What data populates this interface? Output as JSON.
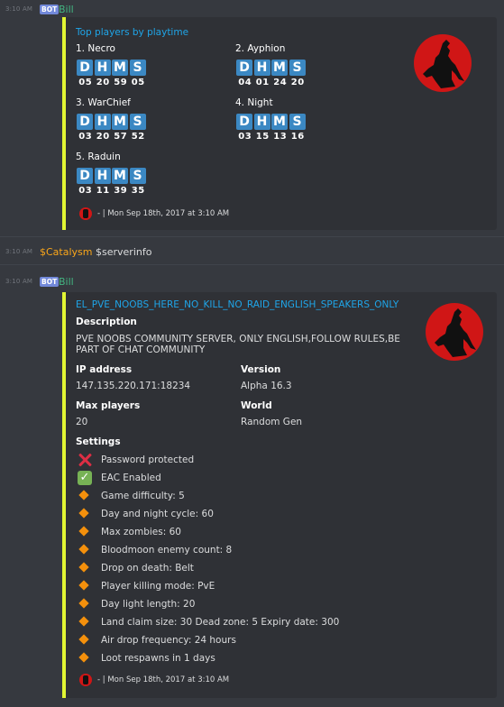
{
  "colors": {
    "accent_bar": "#e1f533",
    "title_link": "#1fa5e8",
    "bot_name": "#43b581",
    "user_name": "#faa61a",
    "badge": "#3b88c3",
    "thumb_red": "#d01616"
  },
  "msg1": {
    "timestamp": "3:10 AM",
    "bot_tag": "BOT",
    "author": "Bill",
    "embed": {
      "title": "Top players by playtime",
      "players": [
        {
          "name": "1. Necro",
          "letters": [
            "D",
            "H",
            "M",
            "S"
          ],
          "values": [
            "05",
            "20",
            "59",
            "05"
          ]
        },
        {
          "name": "2. Ayphion",
          "letters": [
            "D",
            "H",
            "M",
            "S"
          ],
          "values": [
            "04",
            "01",
            "24",
            "20"
          ]
        },
        {
          "name": "3. WarChief",
          "letters": [
            "D",
            "H",
            "M",
            "S"
          ],
          "values": [
            "03",
            "20",
            "57",
            "52"
          ]
        },
        {
          "name": "4. Night",
          "letters": [
            "D",
            "H",
            "M",
            "S"
          ],
          "values": [
            "03",
            "15",
            "13",
            "16"
          ]
        },
        {
          "name": "5. Raduin",
          "letters": [
            "D",
            "H",
            "M",
            "S"
          ],
          "values": [
            "03",
            "11",
            "39",
            "35"
          ]
        }
      ],
      "thumbnail_icon": "zombie-silhouette-icon",
      "footer": "- | Mon Sep 18th, 2017 at 3:10 AM"
    }
  },
  "msg2": {
    "timestamp": "3:10 AM",
    "author": "$Catalysm",
    "content": "$serverinfo"
  },
  "msg3": {
    "timestamp": "3:10 AM",
    "bot_tag": "BOT",
    "author": "Bill",
    "embed": {
      "title": "EL_PVE_NOOBS_HERE_NO_KILL_NO_RAID_ENGLISH_SPEAKERS_ONLY",
      "description_label": "Description",
      "description_line1": "PVE NOOBS COMMUNITY SERVER, ONLY ENGLISH,FOLLOW RULES,BE",
      "description_line2": "PART OF CHAT COMMUNITY",
      "ip_label": "IP address",
      "ip_value": "147.135.220.171:18234",
      "version_label": "Version",
      "version_value": "Alpha 16.3",
      "maxplayers_label": "Max players",
      "maxplayers_value": "20",
      "world_label": "World",
      "world_value": "Random Gen",
      "settings_label": "Settings",
      "settings": [
        {
          "icon": "cross-mark-icon",
          "text": "Password protected"
        },
        {
          "icon": "check-mark-icon",
          "text": "EAC Enabled"
        },
        {
          "icon": "orange-diamond-icon",
          "text": "Game difficulty: 5"
        },
        {
          "icon": "orange-diamond-icon",
          "text": "Day and night cycle: 60"
        },
        {
          "icon": "orange-diamond-icon",
          "text": "Max zombies: 60"
        },
        {
          "icon": "orange-diamond-icon",
          "text": "Bloodmoon enemy count: 8"
        },
        {
          "icon": "orange-diamond-icon",
          "text": "Drop on death: Belt"
        },
        {
          "icon": "orange-diamond-icon",
          "text": "Player killing mode: PvE"
        },
        {
          "icon": "orange-diamond-icon",
          "text": "Day light length: 20"
        },
        {
          "icon": "orange-diamond-icon",
          "text": "Land claim size: 30 Dead zone: 5 Expiry date: 300"
        },
        {
          "icon": "orange-diamond-icon",
          "text": "Air drop frequency: 24 hours"
        },
        {
          "icon": "orange-diamond-icon",
          "text": "Loot respawns in 1 days"
        }
      ],
      "thumbnail_icon": "zombie-silhouette-icon",
      "footer": "- | Mon Sep 18th, 2017 at 3:10 AM"
    }
  }
}
